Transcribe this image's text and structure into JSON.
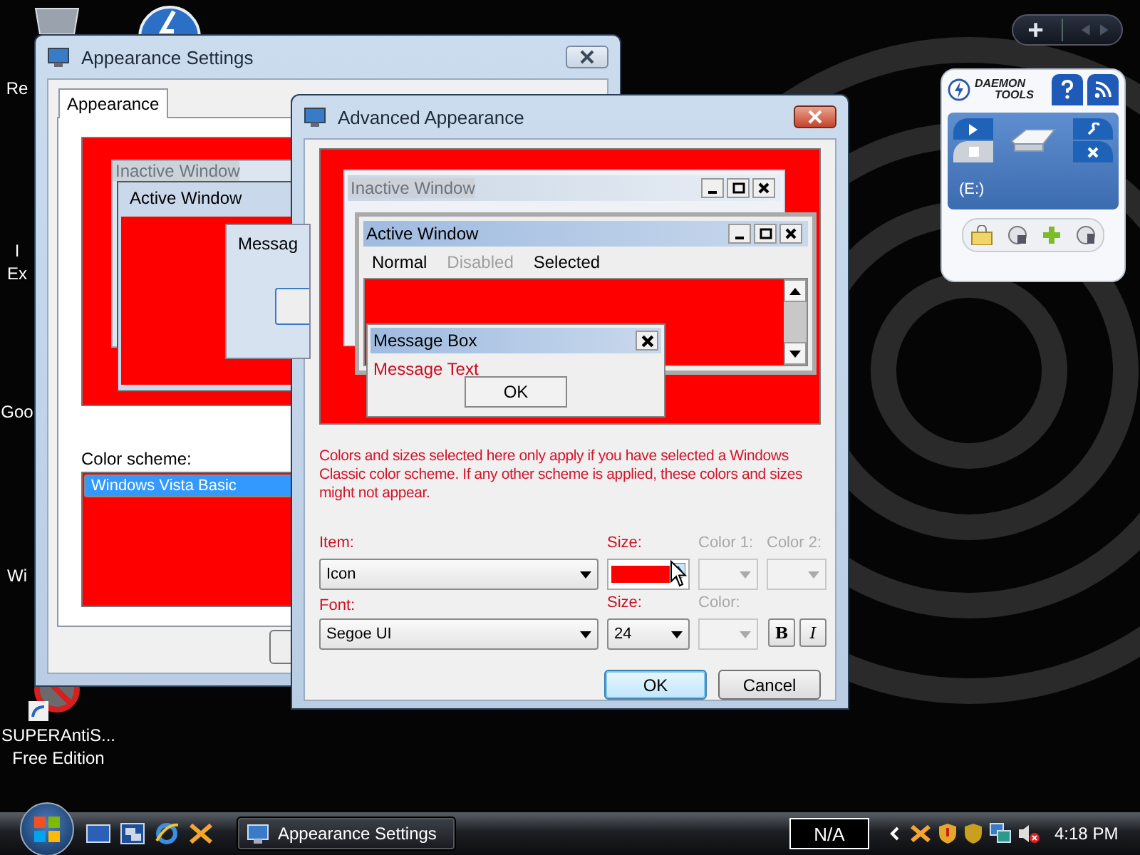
{
  "desktop_icons": [
    {
      "lines": [
        "Re"
      ]
    },
    {
      "lines": [
        "I",
        "Ex"
      ]
    },
    {
      "lines": [
        "Goo"
      ]
    },
    {
      "lines": [
        "Wi"
      ]
    },
    {
      "lines": [
        "SUPERAntiS...",
        "Free Edition"
      ]
    }
  ],
  "gadget": {
    "brand_lines": [
      "DAEMON",
      "TOOLS"
    ],
    "drive": "(E:)"
  },
  "appearance_settings": {
    "title": "Appearance Settings",
    "tabs": [
      {
        "label": "Appearance",
        "selected": true
      }
    ],
    "preview": {
      "inactive_title": "Inactive Window",
      "active_title": "Active Window",
      "message_title": "Messag"
    },
    "color_scheme": {
      "label": "Color scheme:",
      "items": [
        {
          "label": "Windows Vista Basic",
          "selected": true
        }
      ]
    }
  },
  "advanced_appearance": {
    "title": "Advanced Appearance",
    "preview": {
      "inactive_title": "Inactive Window",
      "active_title": "Active Window",
      "menu": [
        {
          "label": "Normal",
          "disabled": false
        },
        {
          "label": "Disabled",
          "disabled": true
        },
        {
          "label": "Selected",
          "disabled": false
        }
      ],
      "message_title": "Message Box",
      "message_text": "Message Text",
      "ok": "OK"
    },
    "note": "Colors and sizes selected here only apply if you have selected a Windows Classic color scheme. If any other scheme is applied, these colors and sizes might not appear.",
    "item": {
      "label": "Item:",
      "value": "Icon"
    },
    "item_size": {
      "label": "Size:"
    },
    "color_1": {
      "label": "Color 1:",
      "disabled": true
    },
    "color_2": {
      "label": "Color 2:",
      "disabled": true
    },
    "font": {
      "label": "Font:",
      "value": "Segoe UI"
    },
    "font_size": {
      "label": "Size:",
      "value": "24"
    },
    "font_color": {
      "label": "Color:",
      "disabled": true
    },
    "bold": "B",
    "italic": "I",
    "buttons": [
      {
        "label": "OK",
        "default": true
      },
      {
        "label": "Cancel",
        "default": false
      }
    ]
  },
  "taskbar": {
    "tasks": [
      {
        "label": "Appearance Settings",
        "selected": false
      }
    ],
    "indicator": "N/A",
    "clock": "4:18 PM"
  }
}
